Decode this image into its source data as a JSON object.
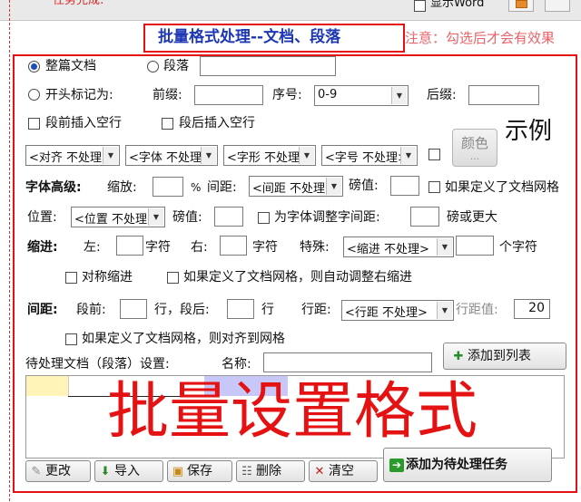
{
  "topbar": {
    "task_done": "任务完成:",
    "show_word": "显示Word"
  },
  "header": {
    "title": "批量格式处理--文档、段落",
    "notice": "注意：勾选后才会有效果"
  },
  "scope": {
    "whole_doc": "整篇文档",
    "paragraph": "段落",
    "prefix_mark": "开头标记为:",
    "prefix_label": "前缀:",
    "seq_label": "序号:",
    "seq_value": "0-9",
    "suffix_label": "后缀:"
  },
  "insert": {
    "before": "段前插入空行",
    "after": "段后插入空行"
  },
  "format_combos": {
    "align": "<对齐 不处理>",
    "font": "<字体 不处理>",
    "shape": "<字形 不处理>",
    "size": "<字号 不处理>",
    "color_btn": "颜色",
    "color_dots": "...",
    "example": "示例"
  },
  "font_adv": {
    "label": "字体高级:",
    "scale": "缩放:",
    "pct": "%",
    "spacing": "间距:",
    "spacing_combo": "<间距 不处理>",
    "pounds": "磅值:",
    "grid_def": "如果定义了文档网格",
    "position": "位置:",
    "position_combo": "<位置 不处理>",
    "pounds2": "磅值:",
    "kerning": "为字体调整字间距:",
    "kerning_unit": "磅或更大"
  },
  "indent": {
    "label": "缩进:",
    "left": "左:",
    "chars1": "字符",
    "right": "右:",
    "chars2": "字符",
    "special": "特殊:",
    "special_combo": "<缩进 不处理>",
    "chars3": "个字符",
    "mirror": "对称缩进",
    "auto_right": "如果定义了文档网格，则自动调整右缩进"
  },
  "spacing": {
    "label": "间距:",
    "before": "段前:",
    "line1": "行，段后:",
    "line2": "行",
    "line_spacing": "行距:",
    "line_combo": "<行距 不处理>",
    "value_label": "行距值:",
    "value": "20",
    "align_grid": "如果定义了文档网格，则对齐到网格"
  },
  "pending": {
    "label": "待处理文档（段落）设置:",
    "name_label": "名称:",
    "add_list": "添加到列表"
  },
  "overlay": {
    "big_title": "批量设置格式"
  },
  "bottom": {
    "edit": "更改",
    "import": "导入",
    "save": "保存",
    "delete": "删除",
    "clear": "清空",
    "add_task": "添加为待处理任务"
  },
  "colors": {
    "accent_red": "#e41212",
    "title_blue": "#1e38b4",
    "notice_red": "#e8646a"
  }
}
